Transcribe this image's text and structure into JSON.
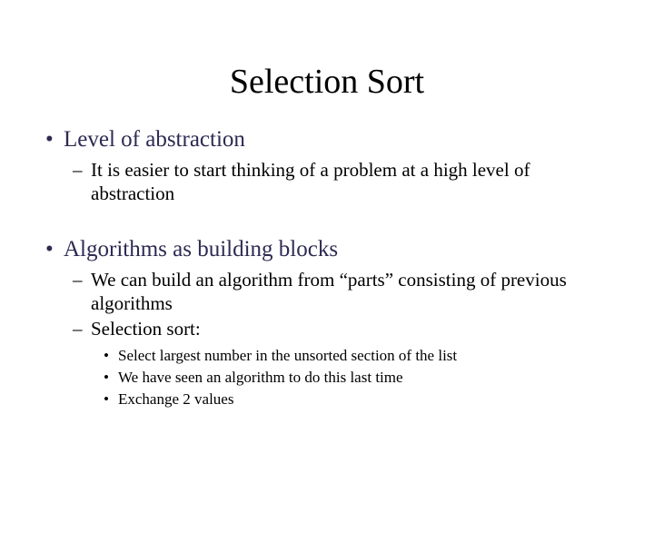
{
  "title": "Selection Sort",
  "bullets": [
    {
      "label": "Level of abstraction",
      "children": [
        {
          "label": "It is easier to start thinking of a problem at a high level of abstraction"
        }
      ]
    },
    {
      "label": "Algorithms as building blocks",
      "children": [
        {
          "label": "We can build an algorithm from “parts” consisting of previous algorithms"
        },
        {
          "label": "Selection sort:",
          "children": [
            {
              "label": "Select largest number in the unsorted section of the list"
            },
            {
              "label": "We have seen an algorithm to do this last time"
            },
            {
              "label": "Exchange 2 values"
            }
          ]
        }
      ]
    }
  ]
}
